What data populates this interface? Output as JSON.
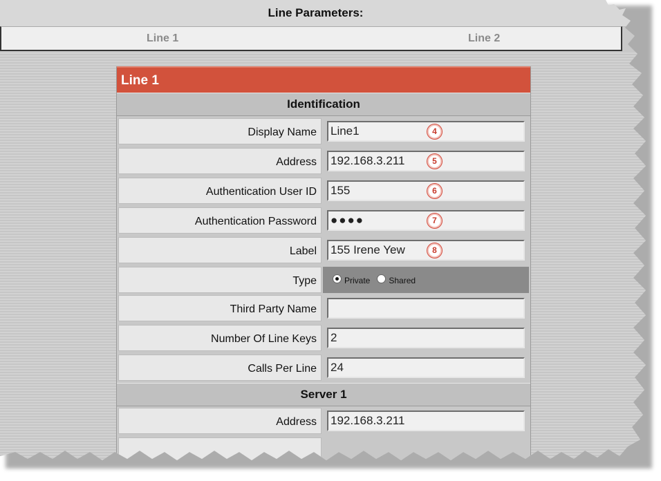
{
  "header": {
    "title": "Line Parameters:"
  },
  "tabs": [
    {
      "label": "Line 1"
    },
    {
      "label": "Line 2"
    }
  ],
  "panel": {
    "title": "Line 1"
  },
  "identification": {
    "title": "Identification",
    "display_name": {
      "label": "Display Name",
      "value": "Line1",
      "badge": "4"
    },
    "address": {
      "label": "Address",
      "value": "192.168.3.211",
      "badge": "5"
    },
    "auth_user_id": {
      "label": "Authentication User ID",
      "value": "155",
      "badge": "6"
    },
    "auth_password": {
      "label": "Authentication Password",
      "value": "●●●●",
      "badge": "7"
    },
    "line_label": {
      "label": "Label",
      "value": "155 Irene Yew",
      "badge": "8"
    },
    "type": {
      "label": "Type",
      "options": [
        "Private",
        "Shared"
      ],
      "selected": "Private"
    },
    "third_party_name": {
      "label": "Third Party Name",
      "value": ""
    },
    "num_line_keys": {
      "label": "Number Of Line Keys",
      "value": "2"
    },
    "calls_per_line": {
      "label": "Calls Per Line",
      "value": "24"
    }
  },
  "server1": {
    "title": "Server 1",
    "address": {
      "label": "Address",
      "value": "192.168.3.211"
    }
  },
  "colors": {
    "panel_header": "#d2523c",
    "badge": "#c73a2c"
  }
}
